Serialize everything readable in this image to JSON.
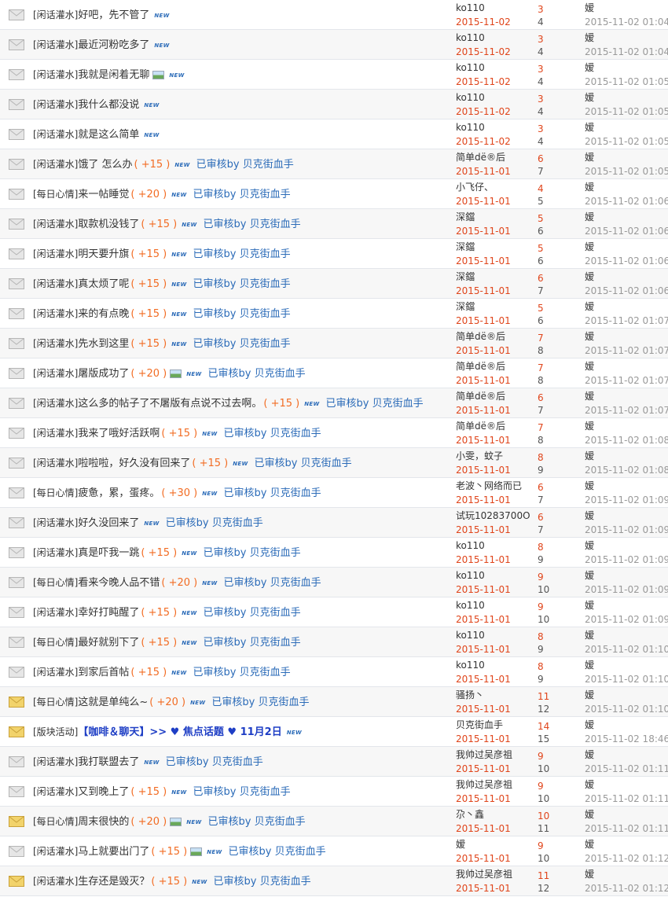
{
  "new_label": "NEW",
  "threads": [
    {
      "cat": "[闲话灌水]",
      "subject": "好吧，先不管了",
      "reward": "",
      "img": false,
      "reviewed": "",
      "author": "ko110",
      "date": "2015-11-02",
      "replies": "3",
      "views": "4",
      "last_user": "嫒",
      "last_time": "2015-11-02 01:04",
      "icon": "envelope-read"
    },
    {
      "cat": "[闲话灌水]",
      "subject": "最近河粉吃多了",
      "reward": "",
      "img": false,
      "reviewed": "",
      "author": "ko110",
      "date": "2015-11-02",
      "replies": "3",
      "views": "4",
      "last_user": "嫒",
      "last_time": "2015-11-02 01:04",
      "icon": "envelope-read"
    },
    {
      "cat": "[闲话灌水]",
      "subject": "我就是闲着无聊",
      "reward": "",
      "img": true,
      "reviewed": "",
      "author": "ko110",
      "date": "2015-11-02",
      "replies": "3",
      "views": "4",
      "last_user": "嫒",
      "last_time": "2015-11-02 01:05",
      "icon": "envelope-read"
    },
    {
      "cat": "[闲话灌水]",
      "subject": "我什么都没说",
      "reward": "",
      "img": false,
      "reviewed": "",
      "author": "ko110",
      "date": "2015-11-02",
      "replies": "3",
      "views": "4",
      "last_user": "嫒",
      "last_time": "2015-11-02 01:05",
      "icon": "envelope-read"
    },
    {
      "cat": "[闲话灌水]",
      "subject": "就是这么简单",
      "reward": "",
      "img": false,
      "reviewed": "",
      "author": "ko110",
      "date": "2015-11-02",
      "replies": "3",
      "views": "4",
      "last_user": "嫒",
      "last_time": "2015-11-02 01:05",
      "icon": "envelope-read"
    },
    {
      "cat": "[闲话灌水]",
      "subject": "饿了 怎么办",
      "reward": "( +15 )",
      "img": false,
      "reviewed": "已审核by 贝克街血手",
      "author": "简单dё®后",
      "date": "2015-11-01",
      "replies": "6",
      "views": "7",
      "last_user": "嫒",
      "last_time": "2015-11-02 01:05",
      "icon": "envelope-read"
    },
    {
      "cat": "[每日心情]",
      "subject": "来一帖睡觉",
      "reward": "( +20 )",
      "img": false,
      "reviewed": "已审核by 贝克街血手",
      "author": "小飞仔、",
      "date": "2015-11-01",
      "replies": "4",
      "views": "5",
      "last_user": "嫒",
      "last_time": "2015-11-02 01:06",
      "icon": "envelope-read"
    },
    {
      "cat": "[闲话灌水]",
      "subject": "取款机没钱了",
      "reward": "( +15 )",
      "img": false,
      "reviewed": "已审核by 贝克街血手",
      "author": "深鐺",
      "date": "2015-11-01",
      "replies": "5",
      "views": "6",
      "last_user": "嫒",
      "last_time": "2015-11-02 01:06",
      "icon": "envelope-read"
    },
    {
      "cat": "[闲话灌水]",
      "subject": "明天要升旗",
      "reward": "( +15 )",
      "img": false,
      "reviewed": "已审核by 贝克街血手",
      "author": "深鐺",
      "date": "2015-11-01",
      "replies": "5",
      "views": "6",
      "last_user": "嫒",
      "last_time": "2015-11-02 01:06",
      "icon": "envelope-read"
    },
    {
      "cat": "[闲话灌水]",
      "subject": "真太烦了呢",
      "reward": "( +15 )",
      "img": false,
      "reviewed": "已审核by 贝克街血手",
      "author": "深鐺",
      "date": "2015-11-01",
      "replies": "6",
      "views": "7",
      "last_user": "嫒",
      "last_time": "2015-11-02 01:06",
      "icon": "envelope-read"
    },
    {
      "cat": "[闲话灌水]",
      "subject": "来的有点晚",
      "reward": "( +15 )",
      "img": false,
      "reviewed": "已审核by 贝克街血手",
      "author": "深鐺",
      "date": "2015-11-01",
      "replies": "5",
      "views": "6",
      "last_user": "嫒",
      "last_time": "2015-11-02 01:07",
      "icon": "envelope-read"
    },
    {
      "cat": "[闲话灌水]",
      "subject": "先水到这里",
      "reward": "( +15 )",
      "img": false,
      "reviewed": "已审核by 贝克街血手",
      "author": "简单dё®后",
      "date": "2015-11-01",
      "replies": "7",
      "views": "8",
      "last_user": "嫒",
      "last_time": "2015-11-02 01:07",
      "icon": "envelope-read"
    },
    {
      "cat": "[闲话灌水]",
      "subject": "屠版成功了",
      "reward": "( +20 )",
      "img": true,
      "reviewed": "已审核by 贝克街血手",
      "author": "简单dё®后",
      "date": "2015-11-01",
      "replies": "7",
      "views": "8",
      "last_user": "嫒",
      "last_time": "2015-11-02 01:07",
      "icon": "envelope-read"
    },
    {
      "cat": "[闲话灌水]",
      "subject": "这么多的帖子了不屠版有点说不过去啊。",
      "reward": "( +15 )",
      "img": false,
      "reviewed": "已审核by 贝克街血手",
      "author": "简单dё®后",
      "date": "2015-11-01",
      "replies": "6",
      "views": "7",
      "last_user": "嫒",
      "last_time": "2015-11-02 01:07",
      "icon": "envelope-read"
    },
    {
      "cat": "[闲话灌水]",
      "subject": "我来了哦好活跃啊",
      "reward": "( +15 )",
      "img": false,
      "reviewed": "已审核by 贝克街血手",
      "author": "简单dё®后",
      "date": "2015-11-01",
      "replies": "7",
      "views": "8",
      "last_user": "嫒",
      "last_time": "2015-11-02 01:08",
      "icon": "envelope-read"
    },
    {
      "cat": "[闲话灌水]",
      "subject": "啦啦啦，好久没有回来了",
      "reward": "( +15 )",
      "img": false,
      "reviewed": "已审核by 贝克街血手",
      "author": "小雯，蚊子",
      "date": "2015-11-01",
      "replies": "8",
      "views": "9",
      "last_user": "嫒",
      "last_time": "2015-11-02 01:08",
      "icon": "envelope-read"
    },
    {
      "cat": "[每日心情]",
      "subject": "疲惫，累，蛋疼。",
      "reward": "( +30 )",
      "img": false,
      "reviewed": "已审核by 贝克街血手",
      "author": "老波丶网络而已",
      "date": "2015-11-01",
      "replies": "6",
      "views": "7",
      "last_user": "嫒",
      "last_time": "2015-11-02 01:09",
      "icon": "envelope-read"
    },
    {
      "cat": "[闲话灌水]",
      "subject": "好久没回来了",
      "reward": "",
      "img": false,
      "reviewed": "已审核by 贝克街血手",
      "author": "试玩10283700O",
      "date": "2015-11-01",
      "replies": "6",
      "views": "7",
      "last_user": "嫒",
      "last_time": "2015-11-02 01:09",
      "icon": "envelope-read"
    },
    {
      "cat": "[闲话灌水]",
      "subject": "真是吓我一跳",
      "reward": "( +15 )",
      "img": false,
      "reviewed": "已审核by 贝克街血手",
      "author": "ko110",
      "date": "2015-11-01",
      "replies": "8",
      "views": "9",
      "last_user": "嫒",
      "last_time": "2015-11-02 01:09",
      "icon": "envelope-read"
    },
    {
      "cat": "[每日心情]",
      "subject": "看来今晚人品不错",
      "reward": "( +20 )",
      "img": false,
      "reviewed": "已审核by 贝克街血手",
      "author": "ko110",
      "date": "2015-11-01",
      "replies": "9",
      "views": "10",
      "last_user": "嫒",
      "last_time": "2015-11-02 01:09",
      "icon": "envelope-read"
    },
    {
      "cat": "[闲话灌水]",
      "subject": "幸好打盹醒了",
      "reward": "( +15 )",
      "img": false,
      "reviewed": "已审核by 贝克街血手",
      "author": "ko110",
      "date": "2015-11-01",
      "replies": "9",
      "views": "10",
      "last_user": "嫒",
      "last_time": "2015-11-02 01:09",
      "icon": "envelope-read"
    },
    {
      "cat": "[每日心情]",
      "subject": "最好就别下了",
      "reward": "( +15 )",
      "img": false,
      "reviewed": "已审核by 贝克街血手",
      "author": "ko110",
      "date": "2015-11-01",
      "replies": "8",
      "views": "9",
      "last_user": "嫒",
      "last_time": "2015-11-02 01:10",
      "icon": "envelope-read"
    },
    {
      "cat": "[闲话灌水]",
      "subject": "到家后首帖",
      "reward": "( +15 )",
      "img": false,
      "reviewed": "已审核by 贝克街血手",
      "author": "ko110",
      "date": "2015-11-01",
      "replies": "8",
      "views": "9",
      "last_user": "嫒",
      "last_time": "2015-11-02 01:10",
      "icon": "envelope-read"
    },
    {
      "cat": "[每日心情]",
      "subject": "这就是单纯么~",
      "reward": "( +20 )",
      "img": false,
      "reviewed": "已审核by 贝克街血手",
      "author": "骚扬丶",
      "date": "2015-11-01",
      "replies": "11",
      "views": "12",
      "last_user": "嫒",
      "last_time": "2015-11-02 01:10",
      "icon": "envelope-hot"
    },
    {
      "cat": "[版块活动]",
      "subject": "【咖啡＆聊天】>> ♥ 焦点话题 ♥ 11月2日",
      "reward": "",
      "img": false,
      "reviewed": "",
      "author": "贝克街血手",
      "date": "2015-11-01",
      "replies": "14",
      "views": "15",
      "last_user": "嫒",
      "last_time": "2015-11-02 18:46",
      "icon": "envelope-hot",
      "highlight": true
    },
    {
      "cat": "[闲话灌水]",
      "subject": "我打联盟去了",
      "reward": "",
      "img": false,
      "reviewed": "已审核by 贝克街血手",
      "author": "我帅过吴彦祖",
      "date": "2015-11-01",
      "replies": "9",
      "views": "10",
      "last_user": "嫒",
      "last_time": "2015-11-02 01:11",
      "icon": "envelope-read"
    },
    {
      "cat": "[闲话灌水]",
      "subject": "又到晚上了",
      "reward": "( +15 )",
      "img": false,
      "reviewed": "已审核by 贝克街血手",
      "author": "我帅过吴彦祖",
      "date": "2015-11-01",
      "replies": "9",
      "views": "10",
      "last_user": "嫒",
      "last_time": "2015-11-02 01:11",
      "icon": "envelope-read"
    },
    {
      "cat": "[每日心情]",
      "subject": "周末很快的",
      "reward": "( +20 )",
      "img": true,
      "reviewed": "已审核by 贝克街血手",
      "author": "尕丶鑫",
      "date": "2015-11-01",
      "replies": "10",
      "views": "11",
      "last_user": "嫒",
      "last_time": "2015-11-02 01:11",
      "icon": "envelope-hot"
    },
    {
      "cat": "[闲话灌水]",
      "subject": "马上就要出门了",
      "reward": "( +15 )",
      "img": true,
      "reviewed": "已审核by 贝克街血手",
      "author": "嫒",
      "date": "2015-11-01",
      "replies": "9",
      "views": "10",
      "last_user": "嫒",
      "last_time": "2015-11-02 01:12",
      "icon": "envelope-read"
    },
    {
      "cat": "[闲话灌水]",
      "subject": "生存还是毁灭？",
      "reward": "( +15 )",
      "img": false,
      "reviewed": "已审核by 贝克街血手",
      "author": "我帅过吴彦祖",
      "date": "2015-11-01",
      "replies": "11",
      "views": "12",
      "last_user": "嫒",
      "last_time": "2015-11-02 01:12",
      "icon": "envelope-hot"
    }
  ]
}
